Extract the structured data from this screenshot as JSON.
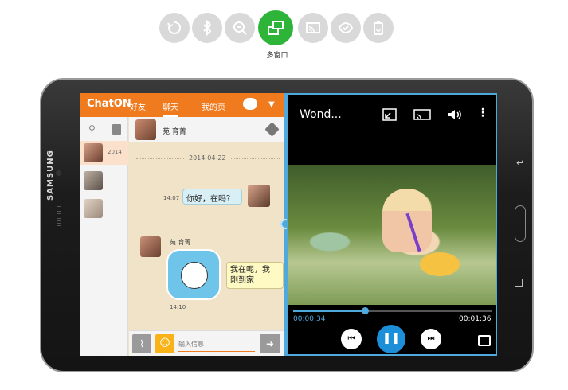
{
  "feature_bar": {
    "icons": [
      {
        "name": "screen-rotation-icon",
        "active": false
      },
      {
        "name": "bluetooth-icon",
        "active": false
      },
      {
        "name": "zoom-out-icon",
        "active": false
      },
      {
        "name": "multi-window-icon",
        "active": true
      },
      {
        "name": "screen-mirroring-icon",
        "active": false
      },
      {
        "name": "smart-stay-icon",
        "active": false
      },
      {
        "name": "power-saving-icon",
        "active": false
      }
    ],
    "active_label": "多窗口",
    "colors": {
      "active": "#2fb43a",
      "inactive": "#d9d9d9"
    }
  },
  "tablet": {
    "brand": "SAMSUNG"
  },
  "chaton": {
    "logo": "ChatON",
    "tabs": [
      {
        "label": "好友",
        "selected": false
      },
      {
        "label": "聊天",
        "selected": true
      },
      {
        "label": "我的页"
      }
    ],
    "accent": "#f07a1e",
    "friend_list": {
      "items": [
        {
          "preview": "2014",
          "selected": true
        },
        {
          "preview": "...",
          "selected": false
        },
        {
          "preview": "...",
          "selected": false
        }
      ]
    },
    "conversation": {
      "contact_name": "苑 育菁",
      "date": "2014-04-22",
      "messages": [
        {
          "direction": "out",
          "time": "14:07",
          "text": "你好，在吗？"
        },
        {
          "direction": "in",
          "sender": "苑 育菁",
          "time": "14:10",
          "text_line1": "我在呢，我",
          "text_line2": "刚到家"
        }
      ]
    },
    "compose": {
      "placeholder": "输入信息"
    }
  },
  "video_player": {
    "title": "Wond...",
    "current_time": "00:00:34",
    "total_time": "00:01:36",
    "progress": 0.36,
    "accent": "#4fa9dd",
    "toolbar_icons": [
      "pop-up-play-icon",
      "screen-mirroring-icon",
      "volume-icon",
      "more-options-icon"
    ],
    "controls": [
      "rewind-icon",
      "pause-icon",
      "fast-forward-icon",
      "fullscreen-icon"
    ]
  }
}
